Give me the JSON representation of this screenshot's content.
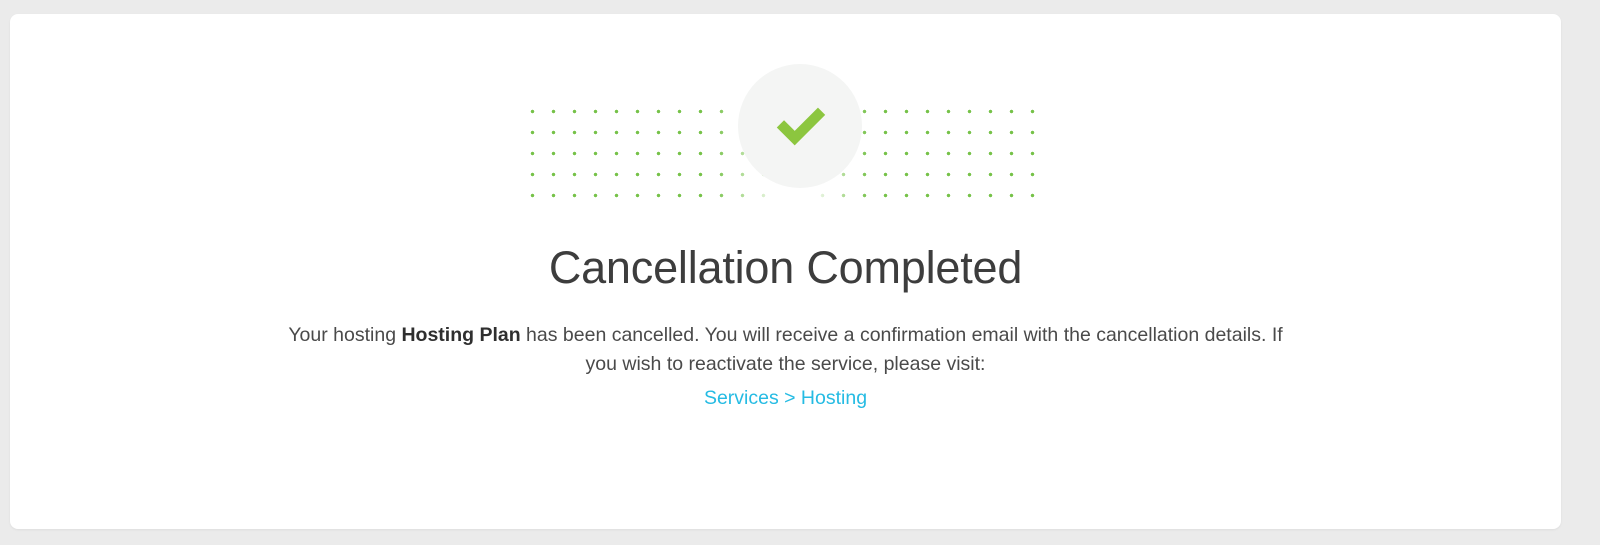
{
  "theme": {
    "page_background": "#ebebeb",
    "card_background": "#ffffff",
    "accent_green": "#8cc63f",
    "dot_green": "#6fbf3f",
    "link_cyan": "#25bbe3",
    "title_color": "#3d3d3d",
    "body_color": "#4a4a4a",
    "icon_circle_background": "#f4f5f4"
  },
  "hero": {
    "status_icon": "check-mark-icon",
    "decoration": "dotted-grid-pattern"
  },
  "main": {
    "title": "Cancellation Completed",
    "description": {
      "before_bold": "Your hosting ",
      "bold": "Hosting Plan",
      "after_bold": " has been cancelled. You will receive a confirmation email with the cancellation details. If you wish to reactivate the service, please visit:"
    },
    "link_label": "Services > Hosting"
  }
}
